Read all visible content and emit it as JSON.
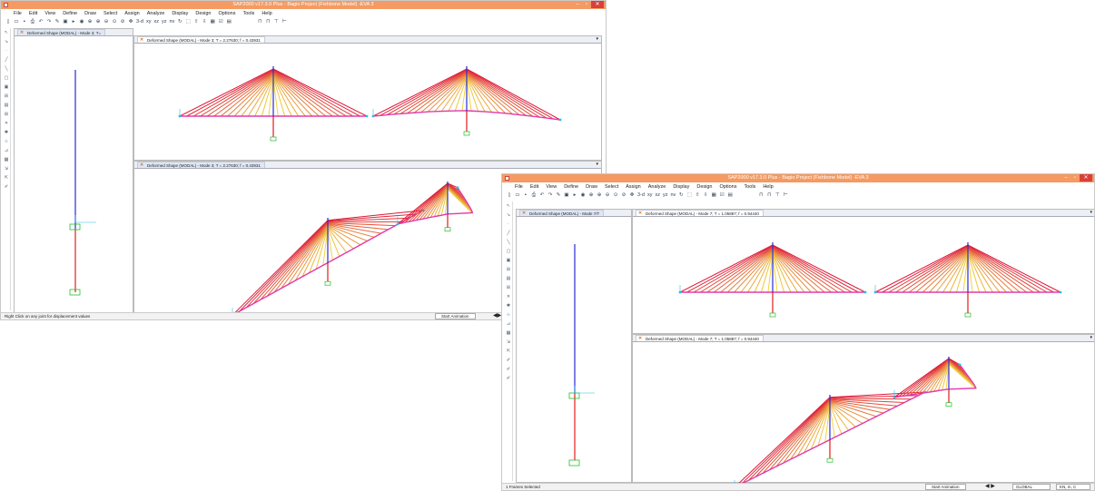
{
  "colors": {
    "titlebar": "#f49a62",
    "cable_outer": "#dd1738",
    "cable_inner": "#f1d440",
    "pylon_top": "#2a2ad8",
    "pylon_bottom": "#e21c1c",
    "support": "#22c02a",
    "axis": "#22c0e6"
  },
  "window1": {
    "title": "SAP2000 v17.3.0 Plus - Bagio Project (Fishbone Model) -EVA 3",
    "menu": [
      "File",
      "Edit",
      "View",
      "Define",
      "Draw",
      "Select",
      "Assign",
      "Analyze",
      "Display",
      "Design",
      "Options",
      "Tools",
      "Help"
    ],
    "toolbar_text": {
      "view_3d": "3-d",
      "xy": "xy",
      "xz": "xz",
      "yz": "yz",
      "nv": "nv"
    },
    "left_pane_tab": "Deformed Shape (MODAL) - Mode 3; T=",
    "top_pane_tab": "Deformed Shape (MODAL) - Mode 3; T = 2.27630; f = 0.43931",
    "bottom_pane_tab": "Deformed Shape (MODAL) - Mode 3; T = 2.27630; f = 0.43931",
    "status_text": "Right Click on any joint for displacement values",
    "start_animation": "Start Animation"
  },
  "window2": {
    "title": "SAP2000 v17.3.0 Plus - Bagio Project (Fishbone Model) -EVA 3",
    "menu": [
      "File",
      "Edit",
      "View",
      "Define",
      "Draw",
      "Select",
      "Assign",
      "Analyze",
      "Display",
      "Design",
      "Options",
      "Tools",
      "Help"
    ],
    "left_pane_tab": "Deformed Shape (MODAL) - Mode 7/T",
    "top_pane_tab": "Deformed Shape (MODAL) - Mode 7; T = 1.05887; f = 0.94440",
    "bottom_pane_tab": "Deformed Shape (MODAL) - Mode 7; T = 1.05887; f = 0.94440",
    "status_text": "1 Frames Selected",
    "start_animation": "Start Animation",
    "coord_system": "GLOBAL",
    "units": "KN, m, C"
  }
}
